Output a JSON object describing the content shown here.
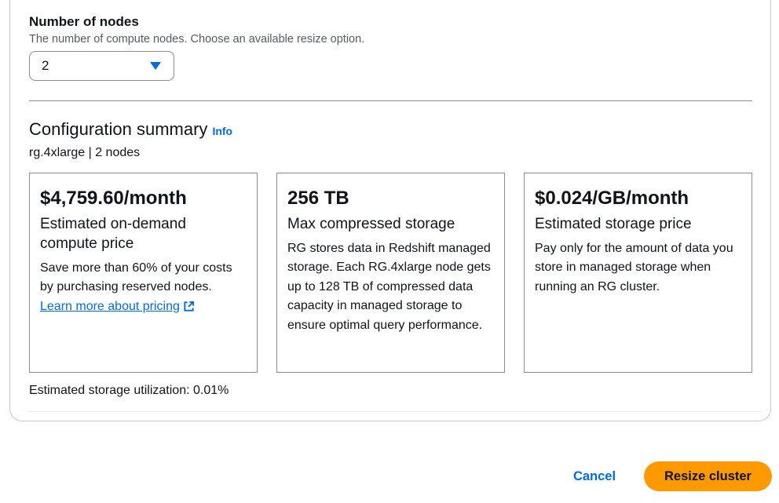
{
  "nodes": {
    "title": "Number of nodes",
    "description": "The number of compute nodes. Choose an available resize option.",
    "selected": "2"
  },
  "summary": {
    "title": "Configuration summary",
    "info": "Info",
    "subtitle": "rg.4xlarge | 2 nodes"
  },
  "cards": [
    {
      "value": "$4,759.60/month",
      "label": "Estimated on-demand compute price",
      "description": "Save more than 60% of your costs by purchasing reserved nodes.",
      "link": "Learn more about pricing"
    },
    {
      "value": "256 TB",
      "label": "Max compressed storage",
      "description": "RG stores data in Redshift managed storage. Each RG.4xlarge node gets up to 128 TB of compressed data capacity in managed storage to ensure optimal query performance."
    },
    {
      "value": "$0.024/GB/month",
      "label": "Estimated storage price",
      "description": "Pay only for the amount of data you store in managed storage when running an RG cluster."
    }
  ],
  "utilization": "Estimated storage utilization: 0.01%",
  "actions": {
    "cancel": "Cancel",
    "resize": "Resize cluster"
  },
  "colors": {
    "primary_button": "#ff9900",
    "link": "#006ce0"
  },
  "icons": [
    "caret-down-icon",
    "external-link-icon"
  ]
}
